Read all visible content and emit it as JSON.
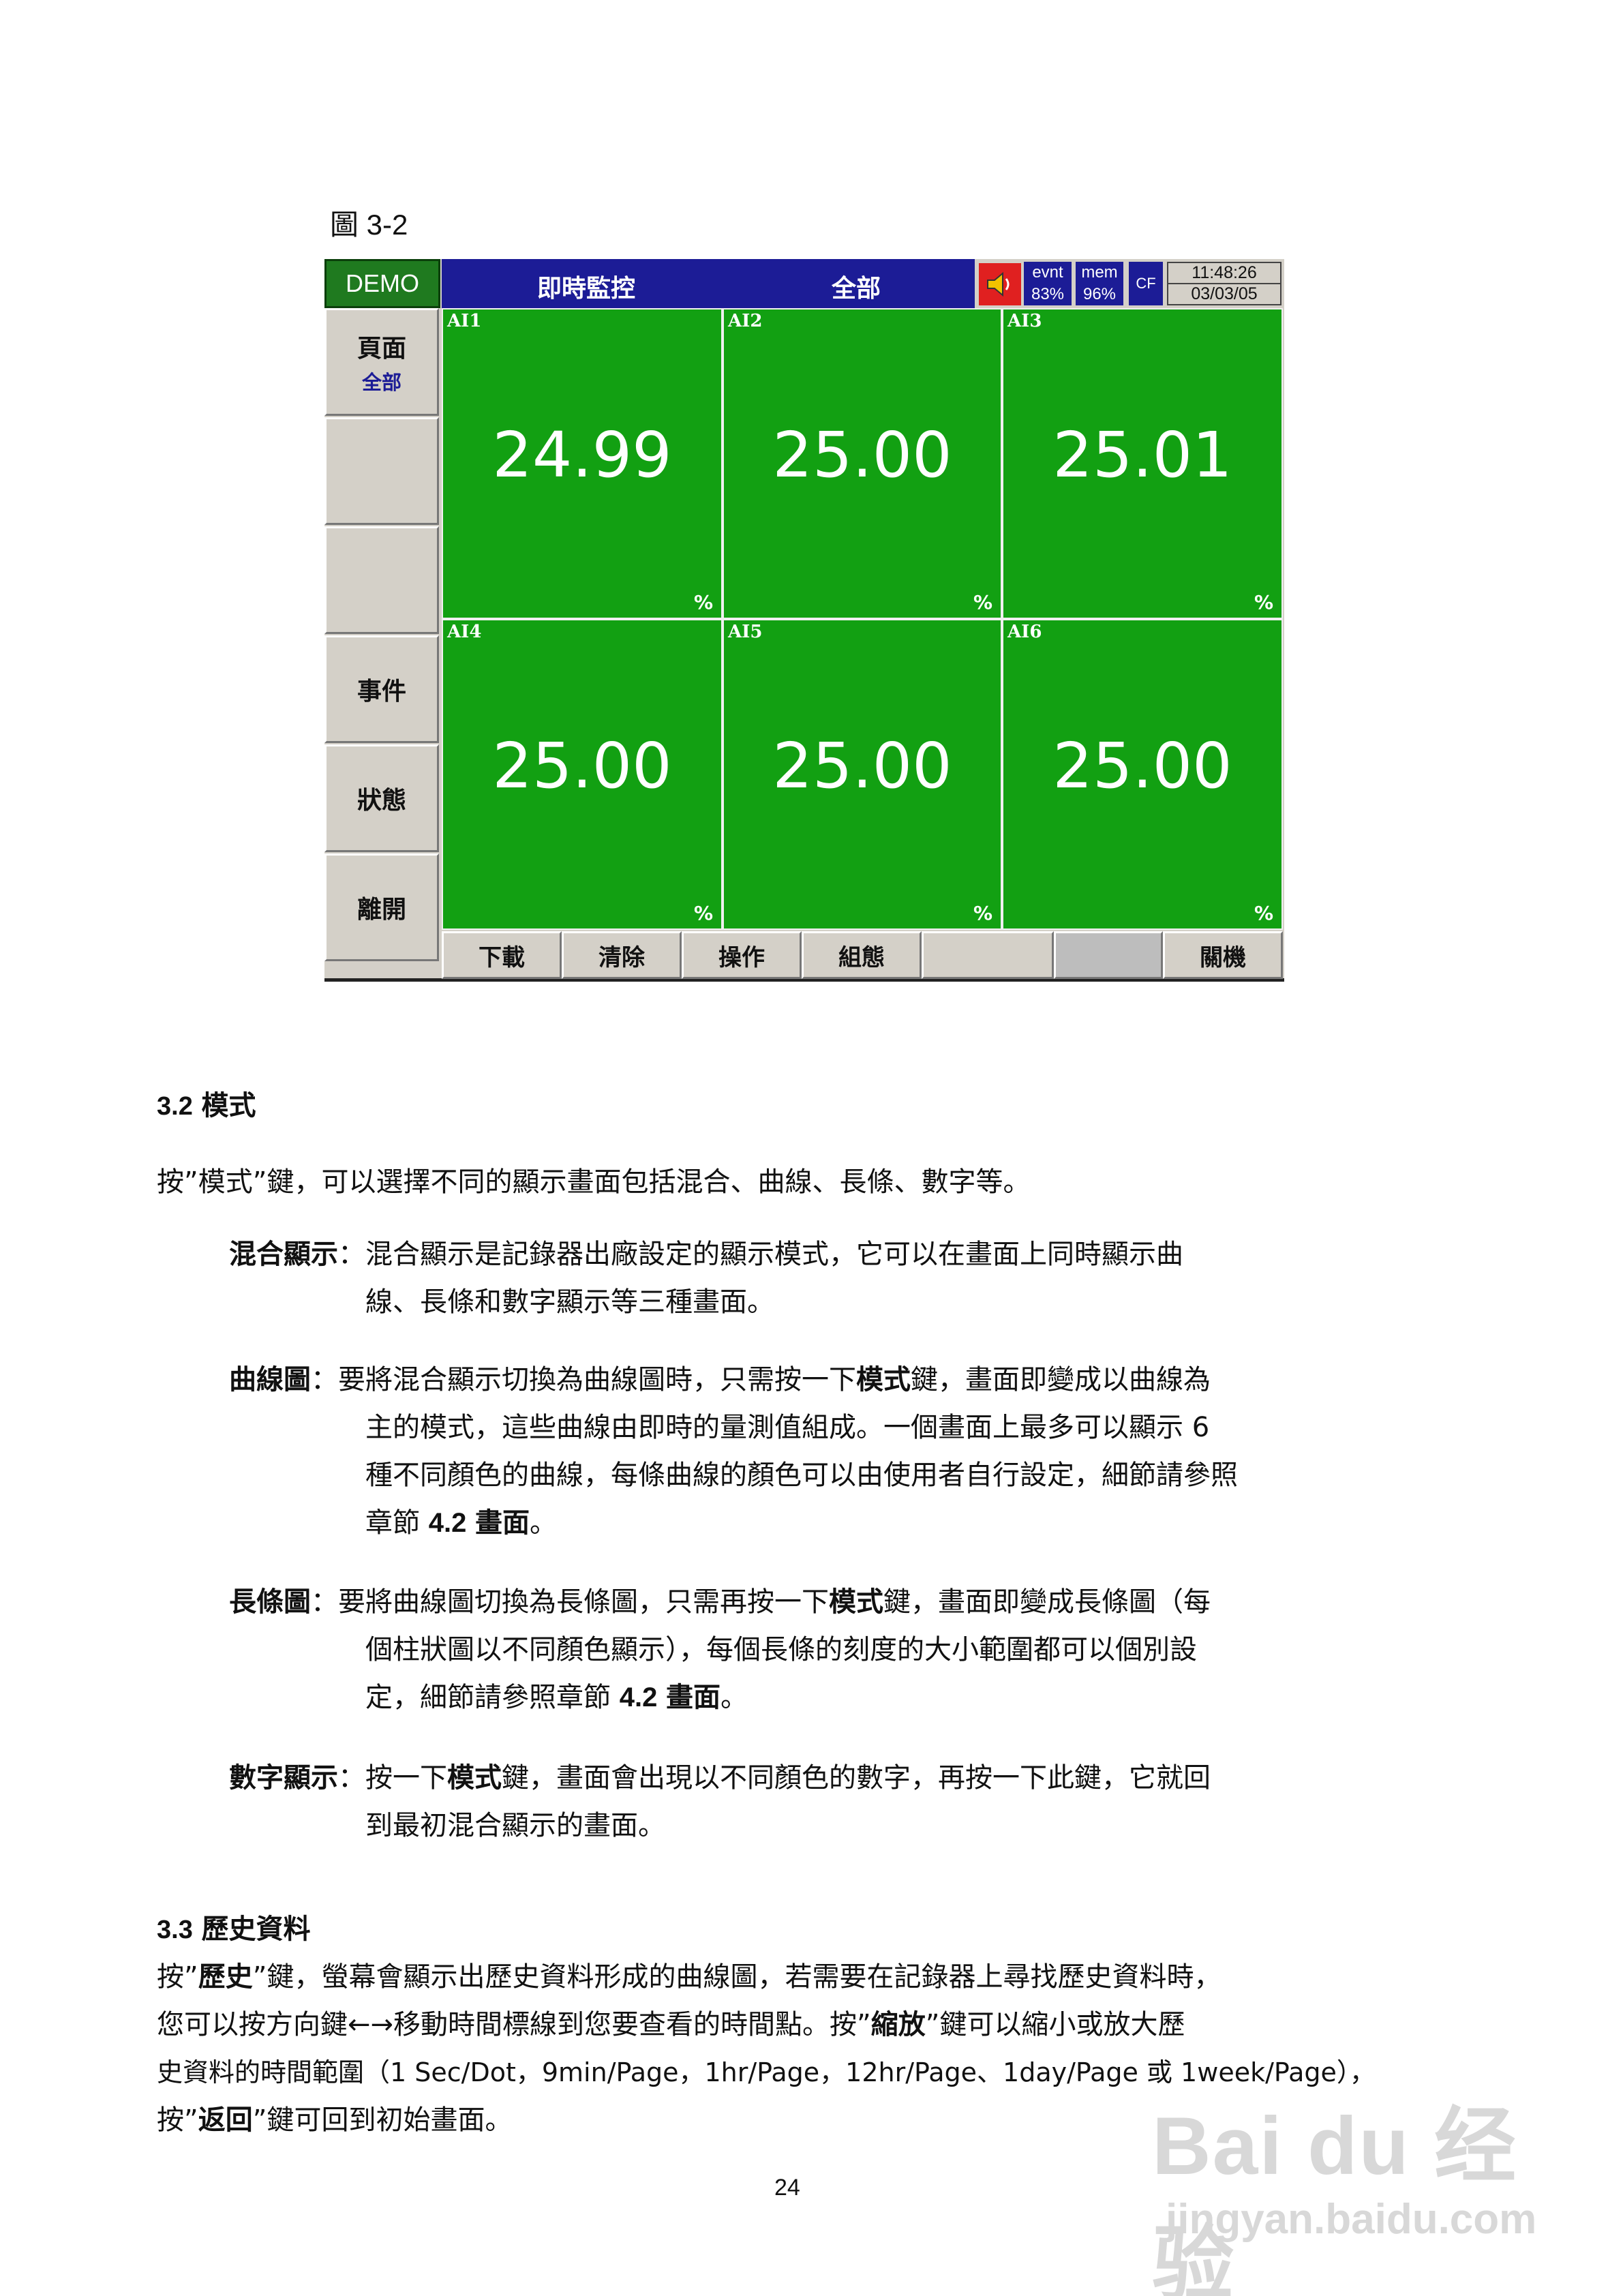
{
  "figure_label": "圖 3-2",
  "screen": {
    "demo": "DEMO",
    "title": "即時監控",
    "group": "全部",
    "evnt_label": "evnt",
    "evnt_value": "83%",
    "mem_label": "mem",
    "mem_value": "96%",
    "cf": "CF",
    "time": "11:48:26",
    "date": "03/03/05",
    "sidebar": {
      "page_label": "頁面",
      "page_sub": "全部",
      "event": "事件",
      "status": "狀態",
      "exit": "離開"
    },
    "channels": [
      {
        "name": "AI1",
        "value": "24.99",
        "unit": "%"
      },
      {
        "name": "AI2",
        "value": "25.00",
        "unit": "%"
      },
      {
        "name": "AI3",
        "value": "25.01",
        "unit": "%"
      },
      {
        "name": "AI4",
        "value": "25.00",
        "unit": "%"
      },
      {
        "name": "AI5",
        "value": "25.00",
        "unit": "%"
      },
      {
        "name": "AI6",
        "value": "25.00",
        "unit": "%"
      }
    ],
    "bottom": {
      "download": "下載",
      "clear": "清除",
      "operate": "操作",
      "config": "組態",
      "shutdown": "關機"
    }
  },
  "body": {
    "s32_num": "3.2",
    "s32_title": "模式",
    "s32_intro": "按”模式”鍵，可以選擇不同的顯示畫面包括混合、曲線、長條、數字等。",
    "mixed_term": "混合顯示",
    "mixed_l1": "：混合顯示是記錄器出廠設定的顯示模式，它可以在畫面上同時顯示曲",
    "mixed_l2": "線、長條和數字顯示等三種畫面。",
    "curve_term": "曲線圖",
    "curve_l1a": "：要將混合顯示切換為曲線圖時，只需按一下",
    "curve_key": "模式",
    "curve_l1b": "鍵，畫面即變成以曲線為",
    "curve_l2": "主的模式，這些曲線由即時的量測值組成。一個畫面上最多可以顯示 6",
    "curve_l3": "種不同顏色的曲線，每條曲線的顏色可以由使用者自行設定，細節請參照",
    "curve_l4a": "章節",
    "curve_ref": "4.2",
    "curve_ref_term": "畫面",
    "curve_l4b": "。",
    "bar_term": "長條圖",
    "bar_l1a": "：要將曲線圖切換為長條圖，只需再按一下",
    "bar_key": "模式",
    "bar_l1b": "鍵，畫面即變成長條圖（每",
    "bar_l2": "個柱狀圖以不同顏色顯示），每個長條的刻度的大小範圍都可以個別設",
    "bar_l3a": "定，細節請參照章節",
    "bar_ref": "4.2",
    "bar_ref_term": "畫面",
    "bar_l3b": "。",
    "num_term": "數字顯示",
    "num_l1a": "：按一下",
    "num_key": "模式",
    "num_l1b": "鍵，畫面會出現以不同顏色的數字，再按一下此鍵，它就回",
    "num_l2": "到最初混合顯示的畫面。",
    "s33_num": "3.3",
    "s33_title": "歷史資料",
    "s33_l1a": "按”",
    "s33_l1_key": "歷史",
    "s33_l1b": "”鍵，螢幕會顯示出歷史資料形成的曲線圖，若需要在記錄器上尋找歷史資料時，",
    "s33_l2a": "您可以按方向鍵←→移動時間標線到您要查看的時間點。按”",
    "s33_l2_key": "縮放",
    "s33_l2b": "”鍵可以縮小或放大歷",
    "s33_l3": "史資料的時間範圍（1 Sec/Dot，9min/Page，1hr/Page，12hr/Page、1day/Page 或 1week/Page），",
    "s33_l4a": "按”",
    "s33_l4_key": "返回",
    "s33_l4b": "”鍵可回到初始畫面。",
    "page_number": "24"
  },
  "watermark": {
    "brand": "Bai du 经验",
    "url": "jingyan.baidu.com"
  }
}
